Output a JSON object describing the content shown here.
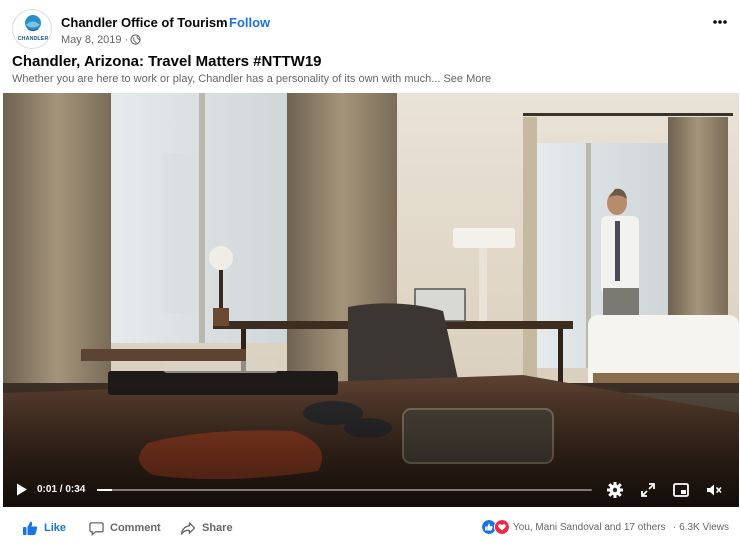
{
  "post": {
    "page_name": "Chandler Office of Tourism",
    "separator": "·",
    "follow_label": "Follow",
    "date": "May 8, 2019 ·",
    "avatar_text": "CHANDLER",
    "title": "Chandler, Arizona: Travel Matters #NTTW19",
    "description": "Whether you are here to work or play, Chandler has a personality of its own with much...",
    "see_more_label": "See More"
  },
  "video": {
    "time_display": "0:01 / 0:34",
    "progress": 0.03
  },
  "actions": {
    "like_label": "Like",
    "comment_label": "Comment",
    "share_label": "Share",
    "reaction_summary": "You, Mani Sandoval and 17 others",
    "views_separator": "·",
    "views": "6.3K Views"
  },
  "colors": {
    "accent": "#1b74e4",
    "like_reaction": "#1b74e4",
    "love_reaction": "#f0284a"
  },
  "icons": [
    "globe-icon",
    "more-options-icon",
    "play-icon",
    "settings-icon",
    "fullscreen-icon",
    "picture-in-picture-icon",
    "mute-icon",
    "like-icon",
    "comment-icon",
    "share-icon"
  ]
}
